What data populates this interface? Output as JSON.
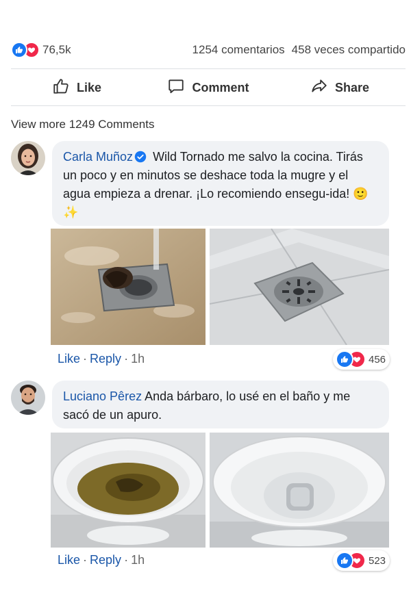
{
  "post": {
    "reaction_count": "76,5k",
    "comments_count": "1254 comentarios",
    "shares_count": "458 veces compartido",
    "reaction_icons": [
      "like-icon",
      "love-icon"
    ]
  },
  "actions": {
    "like": "Like",
    "comment": "Comment",
    "share": "Share"
  },
  "view_more": "View more 1249 Comments",
  "comments": [
    {
      "author": "Carla Muñoz",
      "verified": true,
      "text": "Wild Tornado me salvo la cocina. Tirás un poco y en minutos se deshace toda la mugre y el agua empieza a drenar. ¡Lo recomiendo ensegu-ida!",
      "emoji": "🙂✨",
      "like_label": "Like",
      "reply_label": "Reply",
      "separator": "·",
      "time": "1h",
      "reactions": "456",
      "images": [
        "clogged-floor-drain-photo",
        "clean-floor-drain-photo"
      ]
    },
    {
      "author": "Luciano Pêrez",
      "verified": false,
      "text": "Anda bárbaro, lo usé en el baño y me sacó de un apuro.",
      "like_label": "Like",
      "reply_label": "Reply",
      "separator": "·",
      "time": "1h",
      "reactions": "523",
      "images": [
        "dirty-toilet-photo",
        "clean-toilet-photo"
      ]
    }
  ],
  "colors": {
    "link_blue": "#1a56a8",
    "like_blue": "#1877f2",
    "love_red": "#f0284a",
    "bubble_gray": "#f0f2f5"
  }
}
